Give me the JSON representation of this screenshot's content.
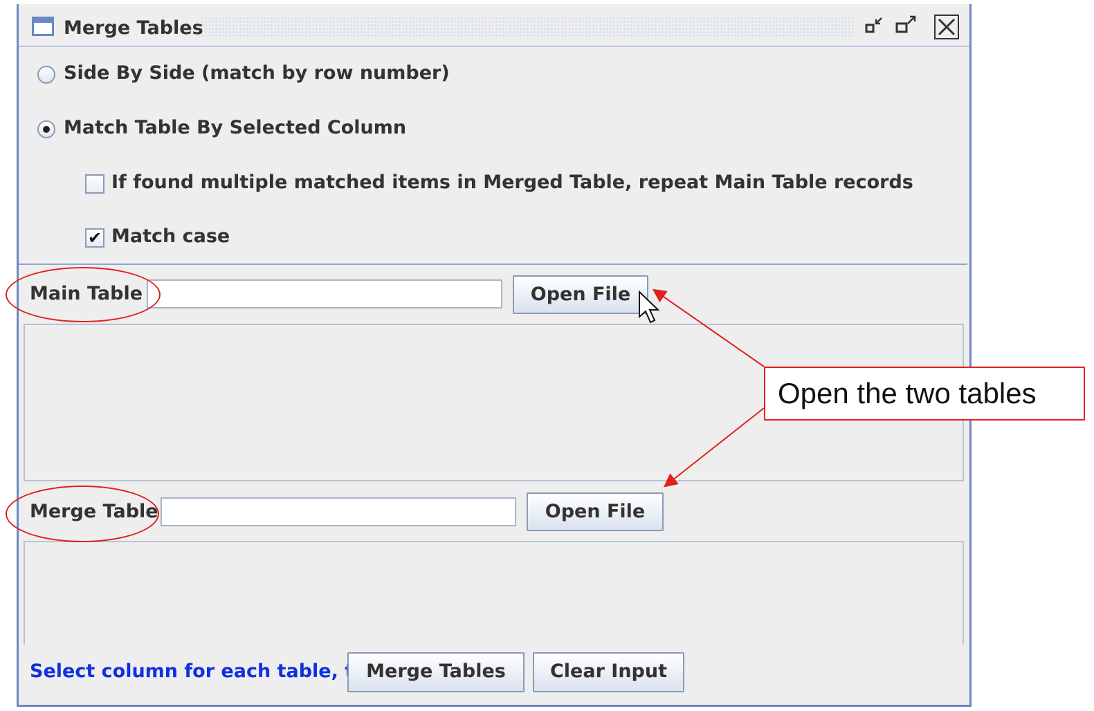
{
  "window": {
    "title": "Merge Tables",
    "buttons": {
      "minimize_icon": "▫↙",
      "maximize_icon": "▫↗",
      "close_icon": "✕"
    }
  },
  "options": {
    "radio_side_by_side": {
      "label": "Side By Side (match by row number)",
      "selected": false
    },
    "radio_match_column": {
      "label": "Match Table By Selected Column",
      "selected": true
    },
    "check_repeat": {
      "label": "If found multiple matched items in Merged Table, repeat Main Table records",
      "checked": false
    },
    "check_match_case": {
      "label": "Match case",
      "checked": true,
      "mark": "✔"
    }
  },
  "main_table": {
    "label": "Main Table :",
    "value": "",
    "button_label": "Open File"
  },
  "merge_table": {
    "label": "Merge Table :",
    "value": "",
    "button_label": "Open File"
  },
  "footer": {
    "status_text": "Select column for each table, then",
    "merge_button_label": "Merge Tables",
    "clear_button_label": "Clear Input"
  },
  "annotation": {
    "callout_text": "Open the two tables",
    "color": "#e0201c"
  },
  "colors": {
    "window_border": "#6b88c4",
    "status_text": "#1030e0"
  }
}
